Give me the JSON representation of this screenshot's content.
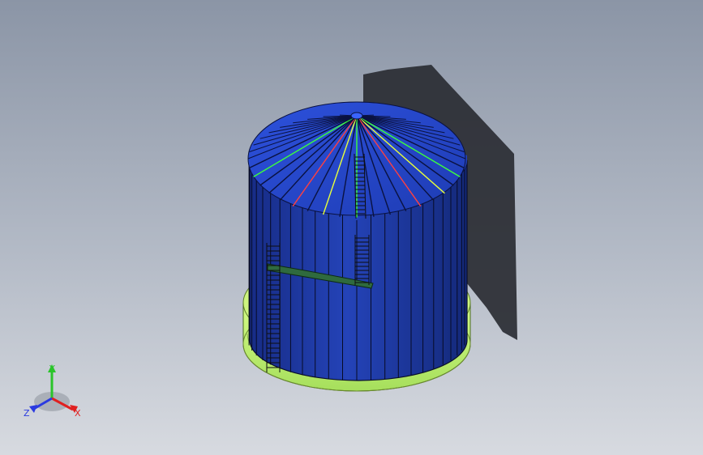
{
  "viewport": {
    "background_top": "#8b95a6",
    "background_bottom": "#d7dae0"
  },
  "model": {
    "tank_color": "#1f3aa8",
    "roof_color": "#2749d2",
    "base_color": "#bff270",
    "shadow_color": "#2a2d33"
  },
  "triad": {
    "x_label": "X",
    "y_label": "Y",
    "z_label": "Z",
    "x_color": "#e02020",
    "y_color": "#2ac42a",
    "z_color": "#2a3ae0"
  }
}
